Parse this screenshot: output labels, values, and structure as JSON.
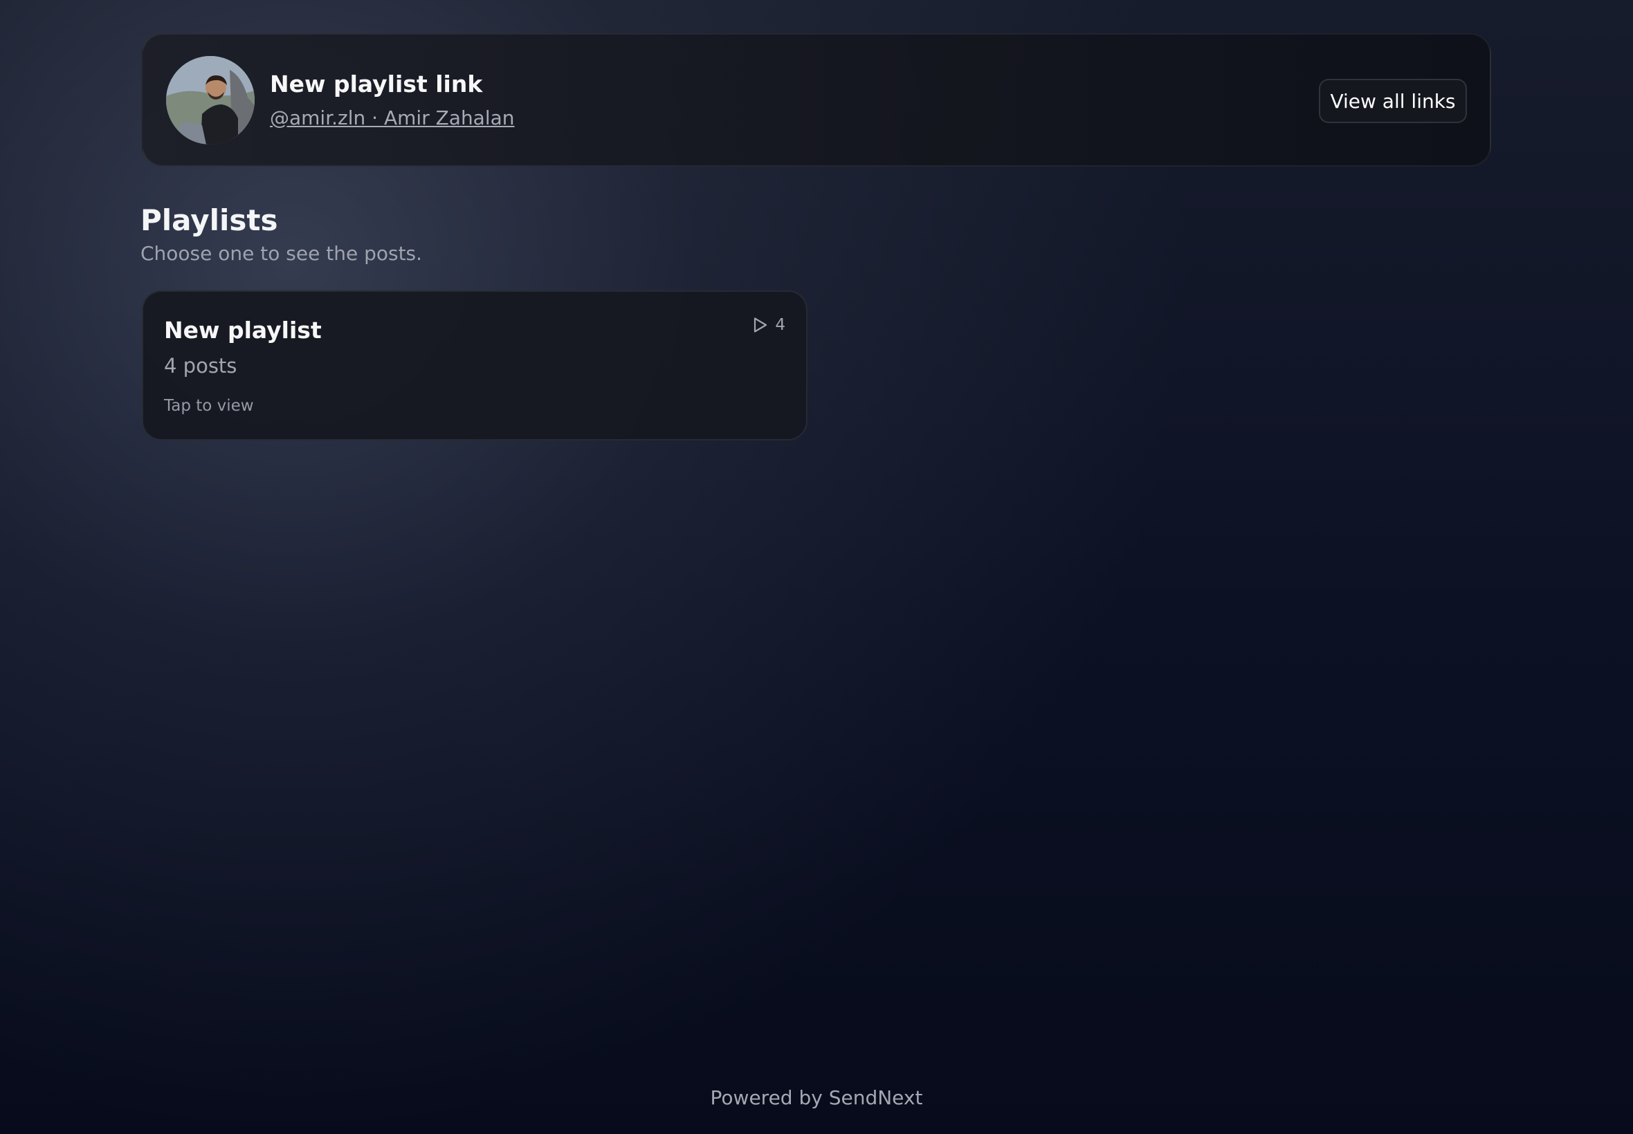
{
  "header": {
    "title": "New playlist link",
    "owner": "@amir.zln · Amir Zahalan",
    "view_all_label": "View all links",
    "avatar_alt": "Amir Zahalan"
  },
  "playlists": {
    "title": "Playlists",
    "subtitle": "Choose one to see the posts.",
    "items": [
      {
        "name": "New playlist",
        "count_text": "4 posts",
        "hint": "Tap to view",
        "badge_count": "4",
        "badge_icon": "play-icon"
      }
    ]
  },
  "footer": {
    "text": "Powered by SendNext"
  },
  "colors": {
    "background": "#0c1124",
    "card": "#16181f",
    "text_primary": "#f7f7f8",
    "text_secondary": "#a2a6b0"
  }
}
